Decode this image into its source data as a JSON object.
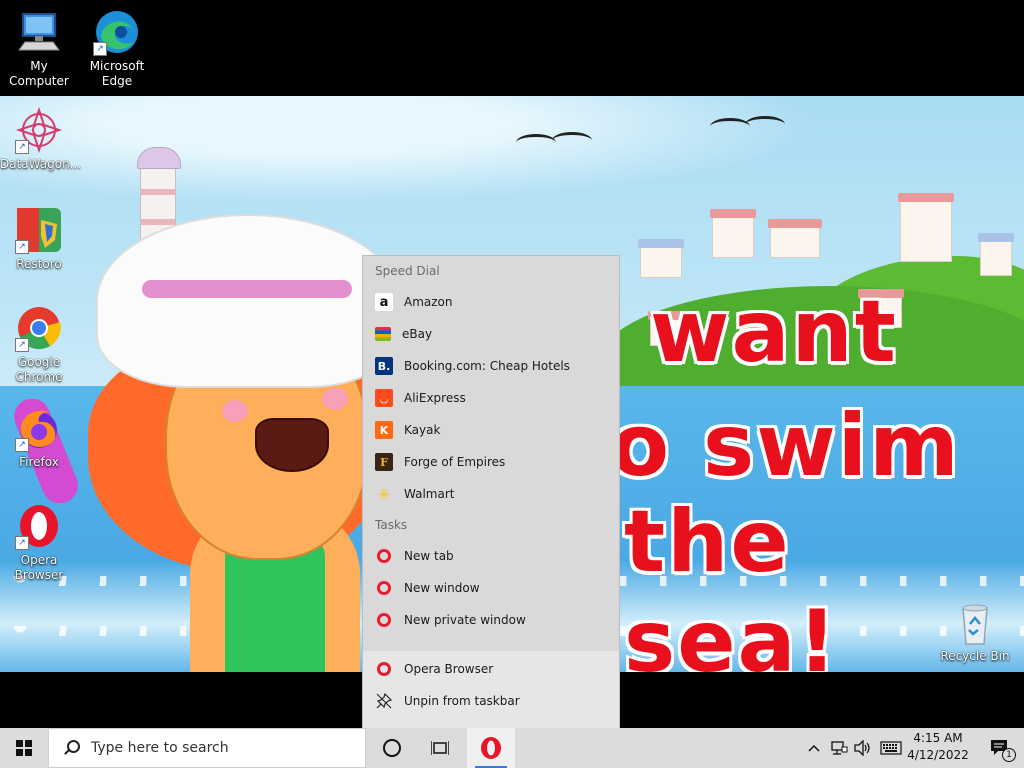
{
  "desktop": {
    "icons": [
      {
        "id": "my-computer",
        "label": "My Computer"
      },
      {
        "id": "microsoft-edge",
        "label": "Microsoft Edge"
      },
      {
        "id": "datawagon",
        "label": "DataWagon..."
      },
      {
        "id": "restoro",
        "label": "Restoro"
      },
      {
        "id": "google-chrome",
        "label": "Google Chrome"
      },
      {
        "id": "firefox",
        "label": "Firefox"
      },
      {
        "id": "opera-browser",
        "label": "Opera Browser"
      },
      {
        "id": "recycle-bin",
        "label": "Recycle Bin"
      }
    ],
    "wallpaper_text": {
      "line1": "want",
      "line2": "o swim",
      "line3": "the sea!"
    }
  },
  "jumplist": {
    "speed_dial_header": "Speed Dial",
    "speed_dial": [
      {
        "label": "Amazon",
        "icon": "amazon-icon"
      },
      {
        "label": "eBay",
        "icon": "ebay-icon"
      },
      {
        "label": "Booking.com: Cheap Hotels",
        "icon": "booking-icon"
      },
      {
        "label": "AliExpress",
        "icon": "aliexpress-icon"
      },
      {
        "label": "Kayak",
        "icon": "kayak-icon"
      },
      {
        "label": "Forge of Empires",
        "icon": "forge-of-empires-icon"
      },
      {
        "label": "Walmart",
        "icon": "walmart-icon"
      }
    ],
    "tasks_header": "Tasks",
    "tasks": [
      {
        "label": "New tab"
      },
      {
        "label": "New window"
      },
      {
        "label": "New private window"
      }
    ],
    "app_name": "Opera Browser",
    "unpin_label": "Unpin from taskbar"
  },
  "taskbar": {
    "search_placeholder": "Type here to search",
    "time": "4:15 AM",
    "date": "4/12/2022",
    "notification_count": "1"
  },
  "colors": {
    "opera_red": "#ea1b2c",
    "taskbar_bg": "#dcdcdc",
    "jumplist_bg": "#d9d9d9"
  }
}
